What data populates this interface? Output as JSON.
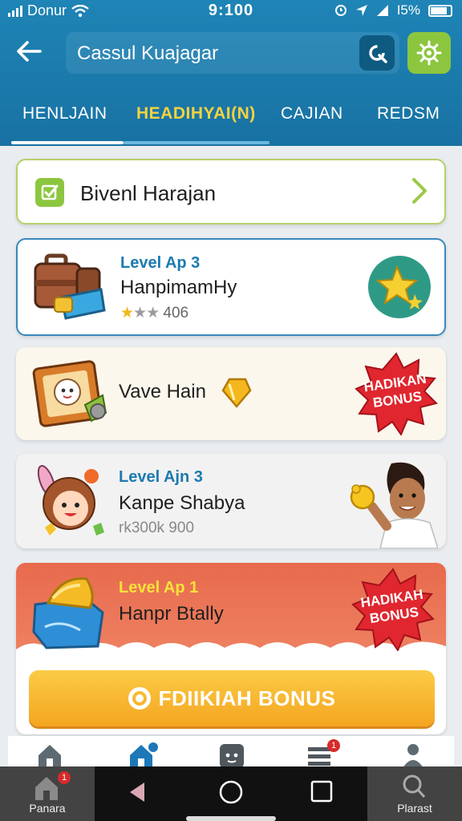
{
  "status_bar": {
    "carrier": "Donur",
    "time": "9:100",
    "battery": "I5%"
  },
  "header": {
    "search_text": "Cassul Kuajagar"
  },
  "tabs": [
    {
      "label": "HENLJAIN",
      "active": false
    },
    {
      "label": "HEADIHYAI(N)",
      "active": true
    },
    {
      "label": "CAJIAN",
      "active": false
    },
    {
      "label": "REDSM",
      "active": false
    }
  ],
  "banner": {
    "title": "Bivenl Harajan"
  },
  "items": [
    {
      "level": "Level Ap 3",
      "name": "HanpimamHy",
      "rating": "406",
      "stars_filled": 1,
      "stars_total": 3
    },
    {
      "name": "Vave Hain",
      "badge": [
        "HADIKAN",
        "BONUS"
      ]
    },
    {
      "level": "Level Ajn 3",
      "name": "Kanpe Shabya",
      "sub": "rk300k 900"
    },
    {
      "level": "Level Ap 1",
      "name": "Hanpr Btally",
      "badge": [
        "HADIKAH",
        "BONUS"
      ]
    }
  ],
  "cta": {
    "label": "FDIIKIAH BONUS"
  },
  "system_bar": {
    "left_label": "Panara",
    "right_label": "Plarast"
  },
  "notifications": {
    "nav_badge": "1",
    "home_badge": "1"
  },
  "colors": {
    "header": "#1c7cae",
    "accent_green": "#8cc63f",
    "active_tab": "#f5d33e",
    "bonus_red": "#e0262e",
    "cta_orange": "#f6ad2a"
  }
}
